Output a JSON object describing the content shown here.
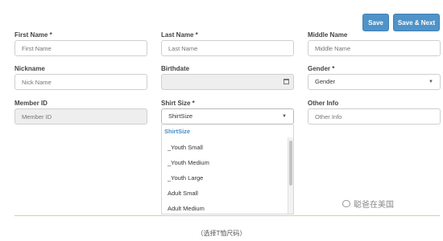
{
  "toolbar": {
    "save_label": "Save",
    "save_next_label": "Save & Next"
  },
  "form": {
    "first_name": {
      "label": "First Name *",
      "placeholder": "First Name",
      "value": ""
    },
    "last_name": {
      "label": "Last Name *",
      "placeholder": "Last Name",
      "value": ""
    },
    "middle_name": {
      "label": "Middle Name",
      "placeholder": "Middle Name",
      "value": ""
    },
    "nickname": {
      "label": "Nickname",
      "placeholder": "Nick Name",
      "value": ""
    },
    "birthdate": {
      "label": "Birthdate",
      "value": "",
      "icon": "calendar-icon"
    },
    "gender": {
      "label": "Gender *",
      "selected": "Gender",
      "icon": "chevron-down-icon"
    },
    "member_id": {
      "label": "Member ID",
      "placeholder": "Member ID",
      "value": ""
    },
    "shirt_size": {
      "label": "Shirt Size *",
      "selected": "ShirtSize",
      "icon": "chevron-down-icon"
    },
    "other_info": {
      "label": "Other Info",
      "placeholder": "Other Info",
      "value": ""
    }
  },
  "shirt_dropdown": {
    "group_header": "ShirtSize",
    "options": [
      "_Youth Small",
      "_Youth Medium",
      "_Youth Large",
      "Adult Small",
      "Adult Medium"
    ]
  },
  "caption": "（选择T恤尺码）",
  "watermark": "聪爸在美国",
  "colors": {
    "button_bg": "#4f93c8",
    "dropdown_header": "#4a8ec5",
    "field_border": "#cfcfcf",
    "disabled_bg": "#eeeeee"
  }
}
